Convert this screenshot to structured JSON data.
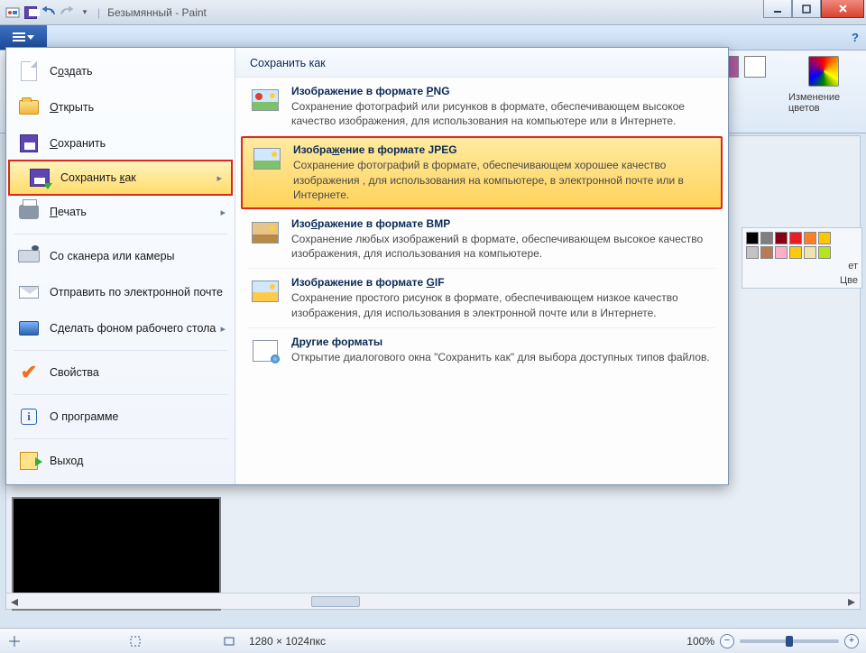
{
  "window": {
    "title": "Безымянный - Paint"
  },
  "ribbon_right": {
    "color1": "#b05aa0",
    "color2": "#ffffff",
    "edit_colors": "Изменение цветов"
  },
  "palette": {
    "row1": [
      "#000000",
      "#7f7f7f",
      "#880015",
      "#ed1c24",
      "#ff7f27",
      "#ffc700"
    ],
    "row2": [
      "#c3c3c3",
      "#b97a57",
      "#ffaec9",
      "#ffc90e",
      "#efe4b0",
      "#b5e61d"
    ],
    "label_partial": "Цве",
    "et_partial": "ет"
  },
  "menu": {
    "items": [
      {
        "key": "new",
        "label": "Создать",
        "u": 1,
        "sub": false
      },
      {
        "key": "open",
        "label": "Открыть",
        "u": 0,
        "sub": false
      },
      {
        "key": "save",
        "label": "Сохранить",
        "u": 0,
        "sub": false
      },
      {
        "key": "saveas",
        "label": "Сохранить как",
        "u": 10,
        "sub": true,
        "hl": true
      },
      {
        "key": "print",
        "label": "Печать",
        "u": 0,
        "sub": true
      },
      {
        "key": "scan",
        "label": "Со сканера или камеры",
        "u": -1,
        "sub": false
      },
      {
        "key": "mail",
        "label": "Отправить по электронной почте",
        "u": -1,
        "sub": false
      },
      {
        "key": "desktop",
        "label": "Сделать фоном рабочего стола",
        "u": -1,
        "sub": true
      },
      {
        "key": "props",
        "label": "Свойства",
        "u": -1,
        "sub": false
      },
      {
        "key": "about",
        "label": "О программе",
        "u": -1,
        "sub": false
      },
      {
        "key": "exit",
        "label": "Выход",
        "u": -1,
        "sub": false
      }
    ]
  },
  "submenu": {
    "title": "Сохранить как",
    "items": [
      {
        "key": "png",
        "title": "Изображение в формате PNG",
        "desc": "Сохранение фотографий или рисунков в формате, обеспечивающем высокое качество изображения, для использования на компьютере или в Интернете."
      },
      {
        "key": "jpeg",
        "title": "Изображение в формате JPEG",
        "selected": true,
        "desc": "Сохранение фотографий в формате, обеспечивающем хорошее качество изображения , для использования на компьютере, в электронной почте или в Интернете."
      },
      {
        "key": "bmp",
        "title": "Изображение в формате BMP",
        "desc": "Сохранение любых изображений в формате, обеспечивающем высокое качество изображения, для использования на компьютере."
      },
      {
        "key": "gif",
        "title": "Изображение в формате GIF",
        "desc": "Сохранение простого рисунок в формате, обеспечивающем низкое качество изображения, для использования в электронной почте или в Интернете."
      },
      {
        "key": "other",
        "title": "Другие форматы",
        "desc": "Открытие диалогового окна \"Сохранить как\" для выбора доступных типов файлов."
      }
    ]
  },
  "status": {
    "dims": "1280 × 1024пкс",
    "zoom": "100%"
  }
}
